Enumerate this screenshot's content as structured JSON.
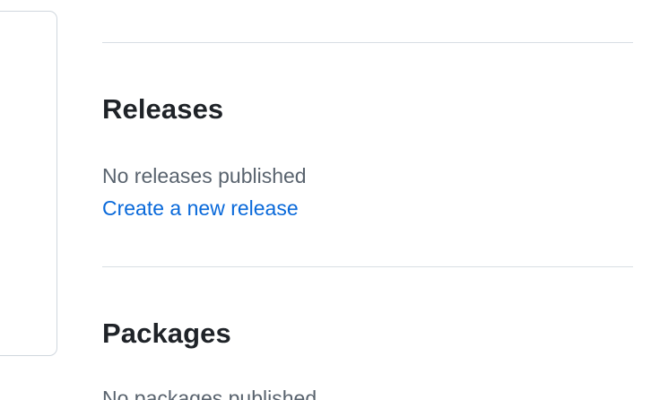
{
  "releases": {
    "title": "Releases",
    "empty_text": "No releases published",
    "create_link": "Create a new release"
  },
  "packages": {
    "title": "Packages",
    "empty_text": "No packages published"
  },
  "icons": {
    "edit": "pencil-icon"
  }
}
